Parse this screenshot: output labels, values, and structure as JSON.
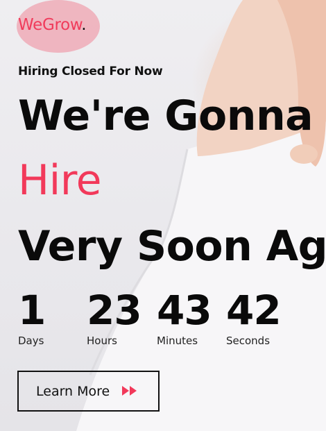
{
  "brand": {
    "name": "WeGrow",
    "dot": ".",
    "brand_color": "#f03b5b",
    "blob_color": "#eeb2bd"
  },
  "hero": {
    "eyebrow": "Hiring Closed For Now",
    "line1": "We're Gonna",
    "line2": "Hire",
    "line3": "Very Soon Again",
    "accent_color": "#f2395a"
  },
  "countdown": [
    {
      "value": "1",
      "label": "Days"
    },
    {
      "value": "23",
      "label": "Hours"
    },
    {
      "value": "43",
      "label": "Minutes"
    },
    {
      "value": "42",
      "label": "Seconds"
    }
  ],
  "cta": {
    "label": "Learn More",
    "icon": "fast-forward-icon"
  }
}
